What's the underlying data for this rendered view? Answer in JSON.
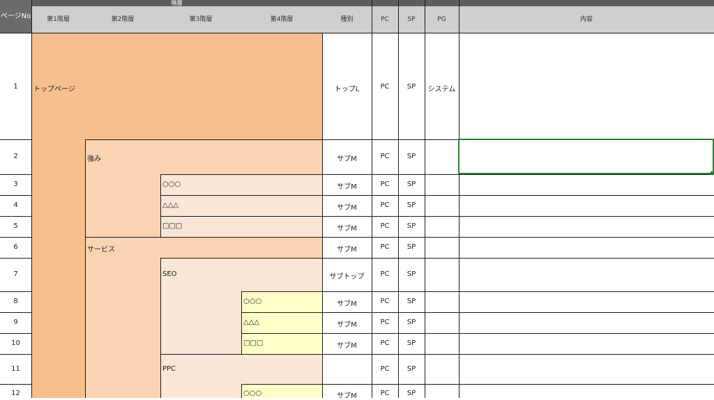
{
  "header": {
    "group": "階層",
    "page_no": "ページNo",
    "level1": "第1階層",
    "level2": "第2階層",
    "level3": "第3階層",
    "level4": "第4階層",
    "type": "種別",
    "pc": "PC",
    "sp": "SP",
    "pg": "PG",
    "content": "内容"
  },
  "colors": {
    "level1_fill": "#f7be8f",
    "level2_fill": "#fad3b3",
    "level3_fill": "#fbe6d7",
    "level4_fill": "#ffffc8",
    "header_fill": "#cfcfcf",
    "header_top": "#5e5e5e",
    "selection": "#2e7d32"
  },
  "rows": [
    {
      "no": "1",
      "label": "トップページ",
      "type": "トップL",
      "pc": "PC",
      "sp": "SP",
      "pg": "システム"
    },
    {
      "no": "2",
      "label": "強み",
      "type": "サブM",
      "pc": "PC",
      "sp": "SP",
      "pg": ""
    },
    {
      "no": "3",
      "label": "○○○",
      "type": "サブM",
      "pc": "PC",
      "sp": "SP",
      "pg": ""
    },
    {
      "no": "4",
      "label": "△△△",
      "type": "サブM",
      "pc": "PC",
      "sp": "SP",
      "pg": ""
    },
    {
      "no": "5",
      "label": "□□□",
      "type": "サブM",
      "pc": "PC",
      "sp": "SP",
      "pg": ""
    },
    {
      "no": "6",
      "label": "サービス",
      "type": "サブM",
      "pc": "PC",
      "sp": "SP",
      "pg": ""
    },
    {
      "no": "7",
      "label": "SEO",
      "type": "サブトップ",
      "pc": "PC",
      "sp": "SP",
      "pg": ""
    },
    {
      "no": "8",
      "label": "○○○",
      "type": "サブM",
      "pc": "PC",
      "sp": "SP",
      "pg": ""
    },
    {
      "no": "9",
      "label": "△△△",
      "type": "サブM",
      "pc": "PC",
      "sp": "SP",
      "pg": ""
    },
    {
      "no": "10",
      "label": "□□□",
      "type": "サブM",
      "pc": "PC",
      "sp": "SP",
      "pg": ""
    },
    {
      "no": "11",
      "label": "PPC",
      "type": "",
      "pc": "PC",
      "sp": "SP",
      "pg": ""
    },
    {
      "no": "12",
      "label": "○○○",
      "type": "サブM",
      "pc": "PC",
      "sp": "SP",
      "pg": ""
    }
  ]
}
